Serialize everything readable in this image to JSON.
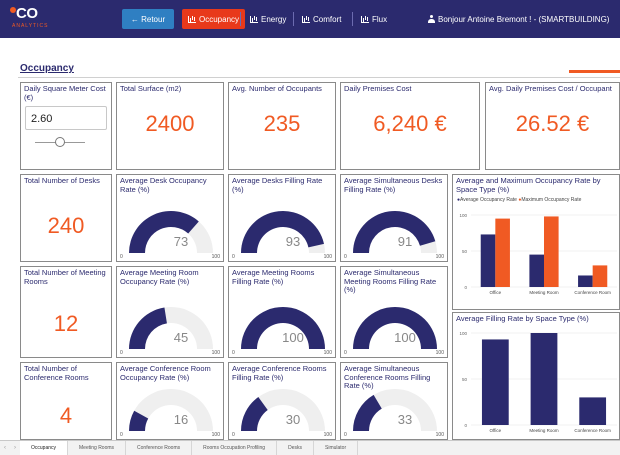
{
  "header": {
    "logo_main": "CO",
    "logo_sub": "ANALYTICS",
    "retour": "← Retour",
    "nav": [
      "Occupancy",
      "Energy",
      "Comfort",
      "Flux"
    ],
    "user": "Bonjour Antoine Bremont ! - (SMARTBUILDING)"
  },
  "page": {
    "title": "Occupancy"
  },
  "cards": {
    "sqm_cost": {
      "title": "Daily Square Meter Cost (€)",
      "value": "2.60"
    },
    "surface": {
      "title": "Total Surface (m2)",
      "value": "2400"
    },
    "occupants": {
      "title": "Avg. Number of Occupants",
      "value": "235"
    },
    "premises_cost": {
      "title": "Daily Premises Cost",
      "value": "6,240 €"
    },
    "cost_per_occ": {
      "title": "Avg. Daily Premises Cost / Occupant",
      "value": "26.52 €"
    },
    "desks": {
      "title": "Total Number of Desks",
      "value": "240"
    },
    "meeting_rooms": {
      "title": "Total Number of Meeting Rooms",
      "value": "12"
    },
    "conf_rooms": {
      "title": "Total Number of Conference Rooms",
      "value": "4"
    }
  },
  "gauges": [
    {
      "title": "Average Desk Occupancy Rate (%)",
      "value": 73,
      "min": "0",
      "max": "100"
    },
    {
      "title": "Average Desks Filling Rate (%)",
      "value": 93,
      "min": "0",
      "max": "100"
    },
    {
      "title": "Average Simultaneous Desks Filling Rate (%)",
      "value": 91,
      "min": "0",
      "max": "100"
    },
    {
      "title": "Average Meeting Room Occupancy Rate (%)",
      "value": 45,
      "min": "0",
      "max": "100"
    },
    {
      "title": "Average Meeting Rooms Filling Rate (%)",
      "value": 100,
      "min": "0",
      "max": "100"
    },
    {
      "title": "Average Simultaneous Meeting Rooms Filling Rate (%)",
      "value": 100,
      "min": "0",
      "max": "100"
    },
    {
      "title": "Average Conference Room Occupancy Rate (%)",
      "value": 16,
      "min": "0",
      "max": "100"
    },
    {
      "title": "Average Conference Rooms Filling Rate (%)",
      "value": 30,
      "min": "0",
      "max": "100"
    },
    {
      "title": "Average Simultaneous Conference Rooms Filling Rate (%)",
      "value": 33,
      "min": "0",
      "max": "100"
    }
  ],
  "colors": {
    "navy": "#2b2a6e",
    "orange": "#f05a23",
    "track": "#efefef"
  },
  "chart_data": [
    {
      "type": "bar",
      "title": "Average and Maximum Occupancy Rate by Space Type (%)",
      "categories": [
        "Office",
        "Meeting Room",
        "Conference Room"
      ],
      "series": [
        {
          "name": "Average Occupancy Rate",
          "values": [
            73,
            45,
            16
          ],
          "color": "#2b2a6e"
        },
        {
          "name": "Maximum Occupancy Rate",
          "values": [
            95,
            98,
            30
          ],
          "color": "#f05a23"
        }
      ],
      "ylim": [
        0,
        100
      ],
      "yticks": [
        "0",
        "50",
        "100"
      ],
      "legend": "top-left"
    },
    {
      "type": "bar",
      "title": "Average Filling Rate by Space Type (%)",
      "categories": [
        "Office",
        "Meeting Room",
        "Conference Room"
      ],
      "series": [
        {
          "values": [
            93,
            100,
            30
          ],
          "color": "#2b2a6e"
        }
      ],
      "ylim": [
        0,
        100
      ],
      "yticks": [
        "0",
        "50",
        "100"
      ]
    }
  ],
  "tabs": [
    "Occupancy",
    "Meeting Rooms",
    "Conference Rooms",
    "Rooms Occupation Profiling",
    "Desks",
    "Simulator"
  ]
}
